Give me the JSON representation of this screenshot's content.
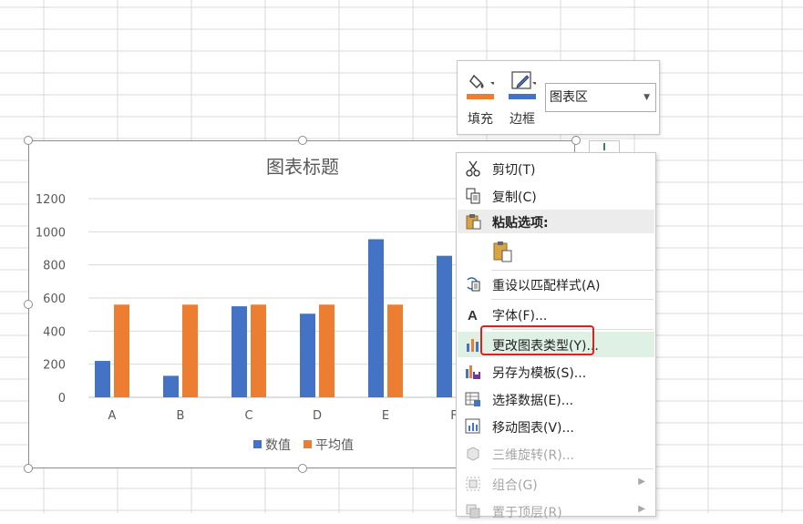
{
  "chart_data": {
    "type": "bar",
    "title": "图表标题",
    "categories": [
      "A",
      "B",
      "C",
      "D",
      "E",
      "F"
    ],
    "series": [
      {
        "name": "数值",
        "values": [
          220,
          130,
          550,
          505,
          955,
          855
        ],
        "color": "#4472c4"
      },
      {
        "name": "平均值",
        "values": [
          560,
          560,
          560,
          560,
          560,
          560
        ],
        "color": "#ed7d31"
      }
    ],
    "y_ticks": [
      "0",
      "200",
      "400",
      "600",
      "800",
      "1000",
      "1200"
    ],
    "ylim": [
      0,
      1200
    ],
    "grid": true,
    "legend_position": "bottom"
  },
  "toolbar": {
    "fill_label": "填充",
    "border_label": "边框",
    "area_value": "图表区",
    "fill_color": "#ed7d31",
    "border_color": "#4472c4"
  },
  "context_menu": {
    "cut": "剪切(T)",
    "copy": "复制(C)",
    "paste_options": "粘贴选项:",
    "reset_style": "重设以匹配样式(A)",
    "font": "字体(F)...",
    "change_chart_type": "更改图表类型(Y)...",
    "save_as_template": "另存为模板(S)...",
    "select_data": "选择数据(E)...",
    "move_chart": "移动图表(V)...",
    "rotate_3d": "三维旋转(R)...",
    "group": "组合(G)",
    "bring_to_front": "置于顶层(R)"
  }
}
